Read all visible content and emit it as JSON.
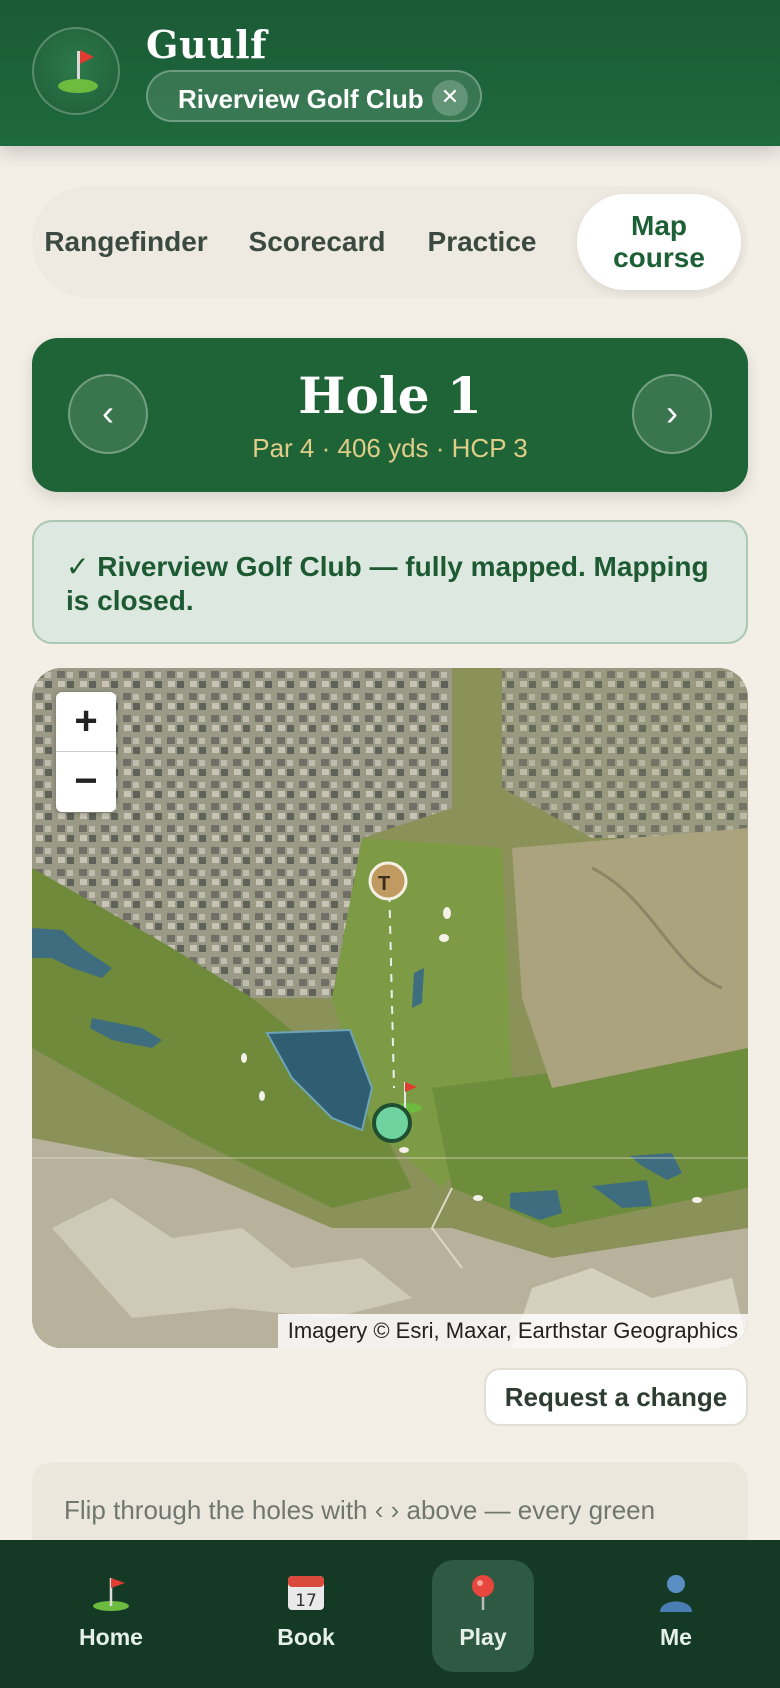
{
  "header": {
    "app_name": "Guulf",
    "logo_icon": "golf-flag-icon",
    "club_name": "Riverview Golf Club",
    "close_glyph": "✕"
  },
  "tabs": [
    {
      "label": "Rangefinder",
      "active": false
    },
    {
      "label": "Scorecard",
      "active": false
    },
    {
      "label": "Practice",
      "active": false
    },
    {
      "label": "Map course",
      "active": true
    }
  ],
  "hole": {
    "prev_glyph": "‹",
    "next_glyph": "›",
    "title": "Hole 1",
    "meta": "Par 4 · 406 yds · HCP 3"
  },
  "status": {
    "text": "✓ Riverview Golf Club — fully mapped. Mapping is closed."
  },
  "map": {
    "zoom_in": "+",
    "zoom_out": "−",
    "tee_label": "T",
    "attribution": "Imagery © Esri, Maxar, Earthstar Geographics"
  },
  "request_button": "Request a change",
  "hint": {
    "text": "Flip through the holes with ‹ › above — every green"
  },
  "bottom_nav": [
    {
      "label": "Home",
      "icon": "golf-flag-icon",
      "active": false
    },
    {
      "label": "Book",
      "icon": "calendar-icon",
      "active": false
    },
    {
      "label": "Play",
      "icon": "map-pin-icon",
      "active": true
    },
    {
      "label": "Me",
      "icon": "person-icon",
      "active": false
    }
  ],
  "colors": {
    "brand_green": "#1e6436",
    "header_green": "#1b5a36",
    "accent_gold": "#e0cd8a",
    "background": "#f3efe7"
  }
}
